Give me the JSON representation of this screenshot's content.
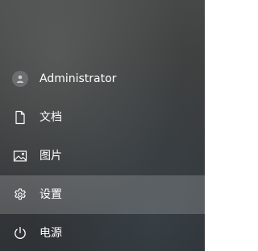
{
  "menu": {
    "items": [
      {
        "id": "account",
        "icon": "user-avatar-icon",
        "label": "Administrator",
        "selected": false
      },
      {
        "id": "documents",
        "icon": "document-icon",
        "label": "文档",
        "selected": false
      },
      {
        "id": "pictures",
        "icon": "picture-icon",
        "label": "图片",
        "selected": false
      },
      {
        "id": "settings",
        "icon": "gear-icon",
        "label": "设置",
        "selected": true
      },
      {
        "id": "power",
        "icon": "power-icon",
        "label": "电源",
        "selected": false
      }
    ]
  },
  "colors": {
    "text": "#ffffff",
    "selected_background": "rgba(255,255,255,0.18)",
    "avatar_background": "#6b6d6f"
  }
}
